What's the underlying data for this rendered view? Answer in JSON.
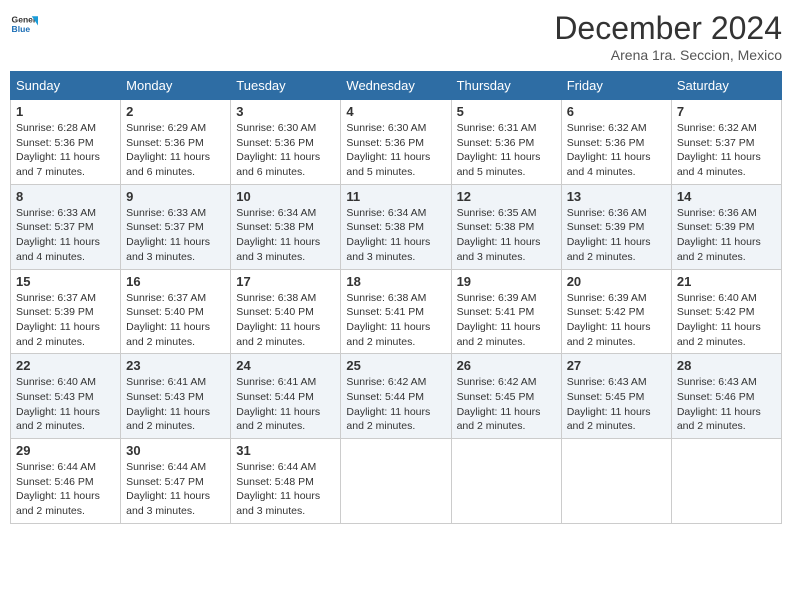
{
  "header": {
    "logo": {
      "line1": "General",
      "line2": "Blue"
    },
    "title": "December 2024",
    "subtitle": "Arena 1ra. Seccion, Mexico"
  },
  "weekdays": [
    "Sunday",
    "Monday",
    "Tuesday",
    "Wednesday",
    "Thursday",
    "Friday",
    "Saturday"
  ],
  "weeks": [
    [
      {
        "day": "1",
        "sunrise": "6:28 AM",
        "sunset": "5:36 PM",
        "daylight": "11 hours and 7 minutes."
      },
      {
        "day": "2",
        "sunrise": "6:29 AM",
        "sunset": "5:36 PM",
        "daylight": "11 hours and 6 minutes."
      },
      {
        "day": "3",
        "sunrise": "6:30 AM",
        "sunset": "5:36 PM",
        "daylight": "11 hours and 6 minutes."
      },
      {
        "day": "4",
        "sunrise": "6:30 AM",
        "sunset": "5:36 PM",
        "daylight": "11 hours and 5 minutes."
      },
      {
        "day": "5",
        "sunrise": "6:31 AM",
        "sunset": "5:36 PM",
        "daylight": "11 hours and 5 minutes."
      },
      {
        "day": "6",
        "sunrise": "6:32 AM",
        "sunset": "5:36 PM",
        "daylight": "11 hours and 4 minutes."
      },
      {
        "day": "7",
        "sunrise": "6:32 AM",
        "sunset": "5:37 PM",
        "daylight": "11 hours and 4 minutes."
      }
    ],
    [
      {
        "day": "8",
        "sunrise": "6:33 AM",
        "sunset": "5:37 PM",
        "daylight": "11 hours and 4 minutes."
      },
      {
        "day": "9",
        "sunrise": "6:33 AM",
        "sunset": "5:37 PM",
        "daylight": "11 hours and 3 minutes."
      },
      {
        "day": "10",
        "sunrise": "6:34 AM",
        "sunset": "5:38 PM",
        "daylight": "11 hours and 3 minutes."
      },
      {
        "day": "11",
        "sunrise": "6:34 AM",
        "sunset": "5:38 PM",
        "daylight": "11 hours and 3 minutes."
      },
      {
        "day": "12",
        "sunrise": "6:35 AM",
        "sunset": "5:38 PM",
        "daylight": "11 hours and 3 minutes."
      },
      {
        "day": "13",
        "sunrise": "6:36 AM",
        "sunset": "5:39 PM",
        "daylight": "11 hours and 2 minutes."
      },
      {
        "day": "14",
        "sunrise": "6:36 AM",
        "sunset": "5:39 PM",
        "daylight": "11 hours and 2 minutes."
      }
    ],
    [
      {
        "day": "15",
        "sunrise": "6:37 AM",
        "sunset": "5:39 PM",
        "daylight": "11 hours and 2 minutes."
      },
      {
        "day": "16",
        "sunrise": "6:37 AM",
        "sunset": "5:40 PM",
        "daylight": "11 hours and 2 minutes."
      },
      {
        "day": "17",
        "sunrise": "6:38 AM",
        "sunset": "5:40 PM",
        "daylight": "11 hours and 2 minutes."
      },
      {
        "day": "18",
        "sunrise": "6:38 AM",
        "sunset": "5:41 PM",
        "daylight": "11 hours and 2 minutes."
      },
      {
        "day": "19",
        "sunrise": "6:39 AM",
        "sunset": "5:41 PM",
        "daylight": "11 hours and 2 minutes."
      },
      {
        "day": "20",
        "sunrise": "6:39 AM",
        "sunset": "5:42 PM",
        "daylight": "11 hours and 2 minutes."
      },
      {
        "day": "21",
        "sunrise": "6:40 AM",
        "sunset": "5:42 PM",
        "daylight": "11 hours and 2 minutes."
      }
    ],
    [
      {
        "day": "22",
        "sunrise": "6:40 AM",
        "sunset": "5:43 PM",
        "daylight": "11 hours and 2 minutes."
      },
      {
        "day": "23",
        "sunrise": "6:41 AM",
        "sunset": "5:43 PM",
        "daylight": "11 hours and 2 minutes."
      },
      {
        "day": "24",
        "sunrise": "6:41 AM",
        "sunset": "5:44 PM",
        "daylight": "11 hours and 2 minutes."
      },
      {
        "day": "25",
        "sunrise": "6:42 AM",
        "sunset": "5:44 PM",
        "daylight": "11 hours and 2 minutes."
      },
      {
        "day": "26",
        "sunrise": "6:42 AM",
        "sunset": "5:45 PM",
        "daylight": "11 hours and 2 minutes."
      },
      {
        "day": "27",
        "sunrise": "6:43 AM",
        "sunset": "5:45 PM",
        "daylight": "11 hours and 2 minutes."
      },
      {
        "day": "28",
        "sunrise": "6:43 AM",
        "sunset": "5:46 PM",
        "daylight": "11 hours and 2 minutes."
      }
    ],
    [
      {
        "day": "29",
        "sunrise": "6:44 AM",
        "sunset": "5:46 PM",
        "daylight": "11 hours and 2 minutes."
      },
      {
        "day": "30",
        "sunrise": "6:44 AM",
        "sunset": "5:47 PM",
        "daylight": "11 hours and 3 minutes."
      },
      {
        "day": "31",
        "sunrise": "6:44 AM",
        "sunset": "5:48 PM",
        "daylight": "11 hours and 3 minutes."
      },
      null,
      null,
      null,
      null
    ]
  ],
  "labels": {
    "sunrise": "Sunrise:",
    "sunset": "Sunset:",
    "daylight": "Daylight:"
  }
}
